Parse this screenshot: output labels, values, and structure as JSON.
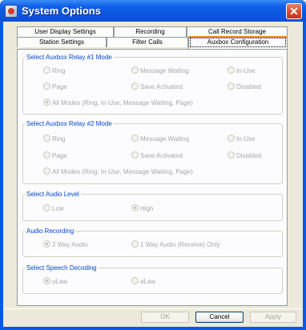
{
  "window": {
    "title": "System Options",
    "close_symbol": "✕"
  },
  "tabs": {
    "row1": [
      "User Display Settings",
      "Recording",
      "Call Record Storage"
    ],
    "row2": [
      "Station Settings",
      "Filter Calls",
      "Auxbox Configuration"
    ],
    "active": "Auxbox Configuration"
  },
  "relay1": {
    "legend": "Select Auxbox Relay #1 Mode",
    "options": [
      "Ring",
      "Message Waiting",
      "In-Use",
      "Page",
      "Save Activated",
      "Disabled"
    ],
    "all_modes": "All Modes (Ring, In-Use, Message Waiting, Page)",
    "selected": "All Modes (Ring, In-Use, Message Waiting, Page)"
  },
  "relay2": {
    "legend": "Select Auxbox Relay #2 Mode",
    "options": [
      "Ring",
      "Message Waiting",
      "In-Use",
      "Page",
      "Save Activated",
      "Disabled"
    ],
    "all_modes": "All Modes (Ring, In-Use, Message Waiting, Page)",
    "selected": "none"
  },
  "audio_level": {
    "legend": "Select Audio Level",
    "options": [
      "Low",
      "High"
    ],
    "selected": "High"
  },
  "audio_recording": {
    "legend": "Audio Recording",
    "options": [
      "2 Way Audio",
      "1 Way Audio (Receive) Only"
    ],
    "selected": "2 Way Audio"
  },
  "speech_decoding": {
    "legend": "Select Speech Decoding",
    "options": [
      "uLaw",
      "aLaw"
    ],
    "selected": "uLaw"
  },
  "buttons": {
    "ok": "OK",
    "cancel": "Cancel",
    "apply": "Apply"
  }
}
